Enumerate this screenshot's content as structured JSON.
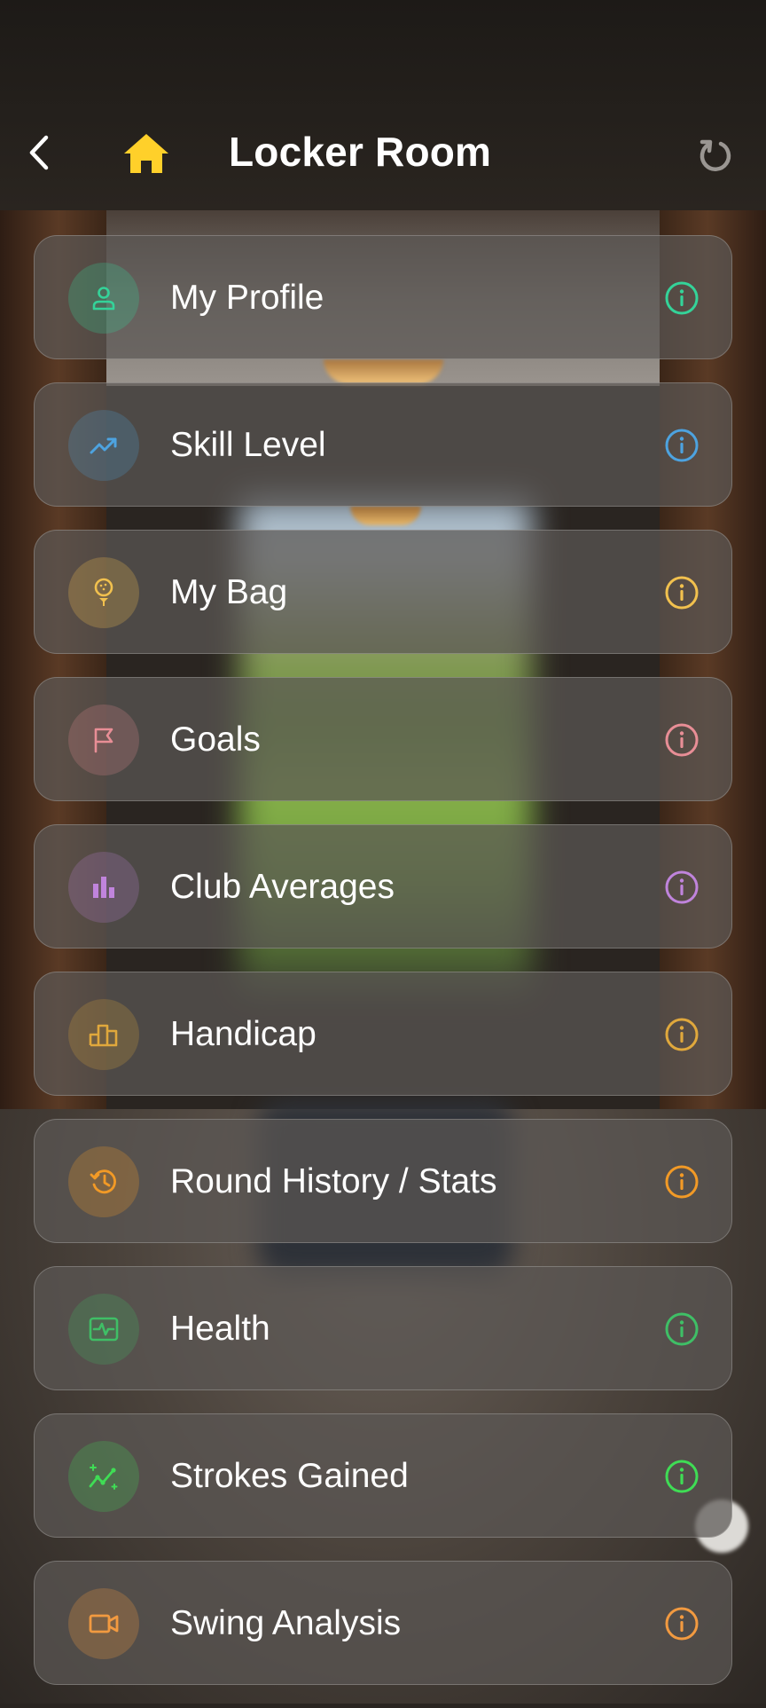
{
  "header": {
    "title": "Locker Room",
    "back_icon": "chevron-left-icon",
    "home_icon": "home-icon",
    "refresh_icon": "refresh-icon",
    "home_color": "#FFD02A"
  },
  "menu": {
    "items": [
      {
        "label": "My Profile",
        "icon": "user-icon",
        "color": "#34D399"
      },
      {
        "label": "Skill Level",
        "icon": "trending-up-icon",
        "color": "#4DA3E0"
      },
      {
        "label": "My Bag",
        "icon": "golf-ball-tee-icon",
        "color": "#F2C14E"
      },
      {
        "label": "Goals",
        "icon": "flag-icon",
        "color": "#E88E96"
      },
      {
        "label": "Club Averages",
        "icon": "bar-chart-icon",
        "color": "#C084DC"
      },
      {
        "label": "Handicap",
        "icon": "podium-icon",
        "color": "#E0A83C"
      },
      {
        "label": "Round History / Stats",
        "icon": "history-icon",
        "color": "#F29A26"
      },
      {
        "label": "Health",
        "icon": "activity-monitor-icon",
        "color": "#3FBF66"
      },
      {
        "label": "Strokes Gained",
        "icon": "sparkline-icon",
        "color": "#3FDD55"
      },
      {
        "label": "Swing Analysis",
        "icon": "video-camera-icon",
        "color": "#F29A40"
      }
    ]
  }
}
